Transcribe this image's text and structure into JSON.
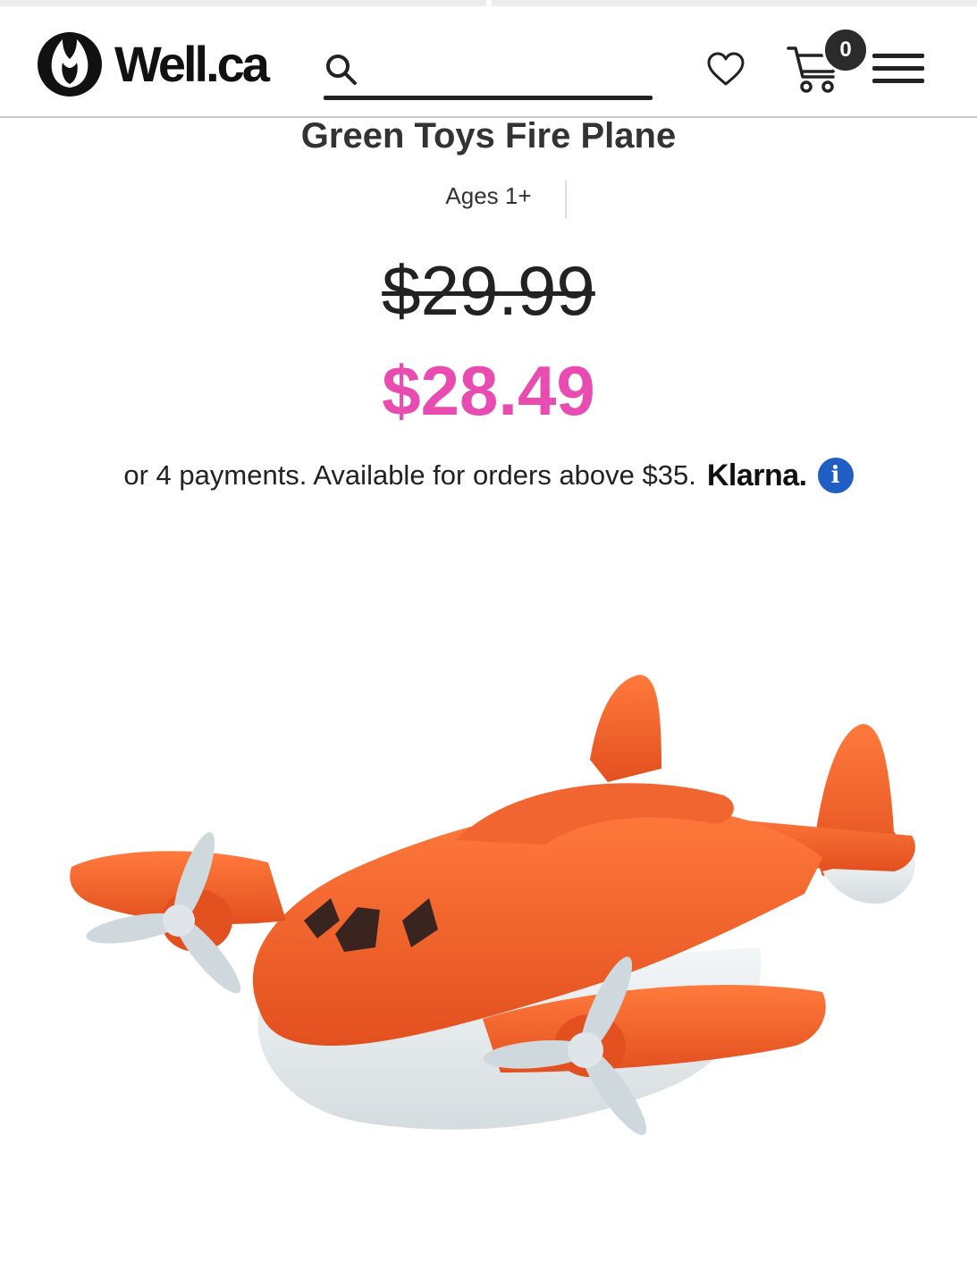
{
  "header": {
    "logo_text": "Well.ca",
    "search": {
      "placeholder": "",
      "value": ""
    },
    "cart_count": "0"
  },
  "product": {
    "title": "Green Toys Fire Plane",
    "ages": "Ages 1+",
    "original_price": "$29.99",
    "sale_price": "$28.49",
    "payment_text": "or 4 payments. Available for orders above $35.",
    "payment_provider": "Klarna."
  },
  "colors": {
    "sale_price": "#e84cb0",
    "info_icon": "#1f5fc4",
    "plane_orange": "#f4602c",
    "plane_white": "#e9eef0"
  },
  "icons": [
    "logo-tulip-icon",
    "search-icon",
    "heart-icon",
    "cart-icon",
    "menu-icon",
    "info-icon"
  ]
}
